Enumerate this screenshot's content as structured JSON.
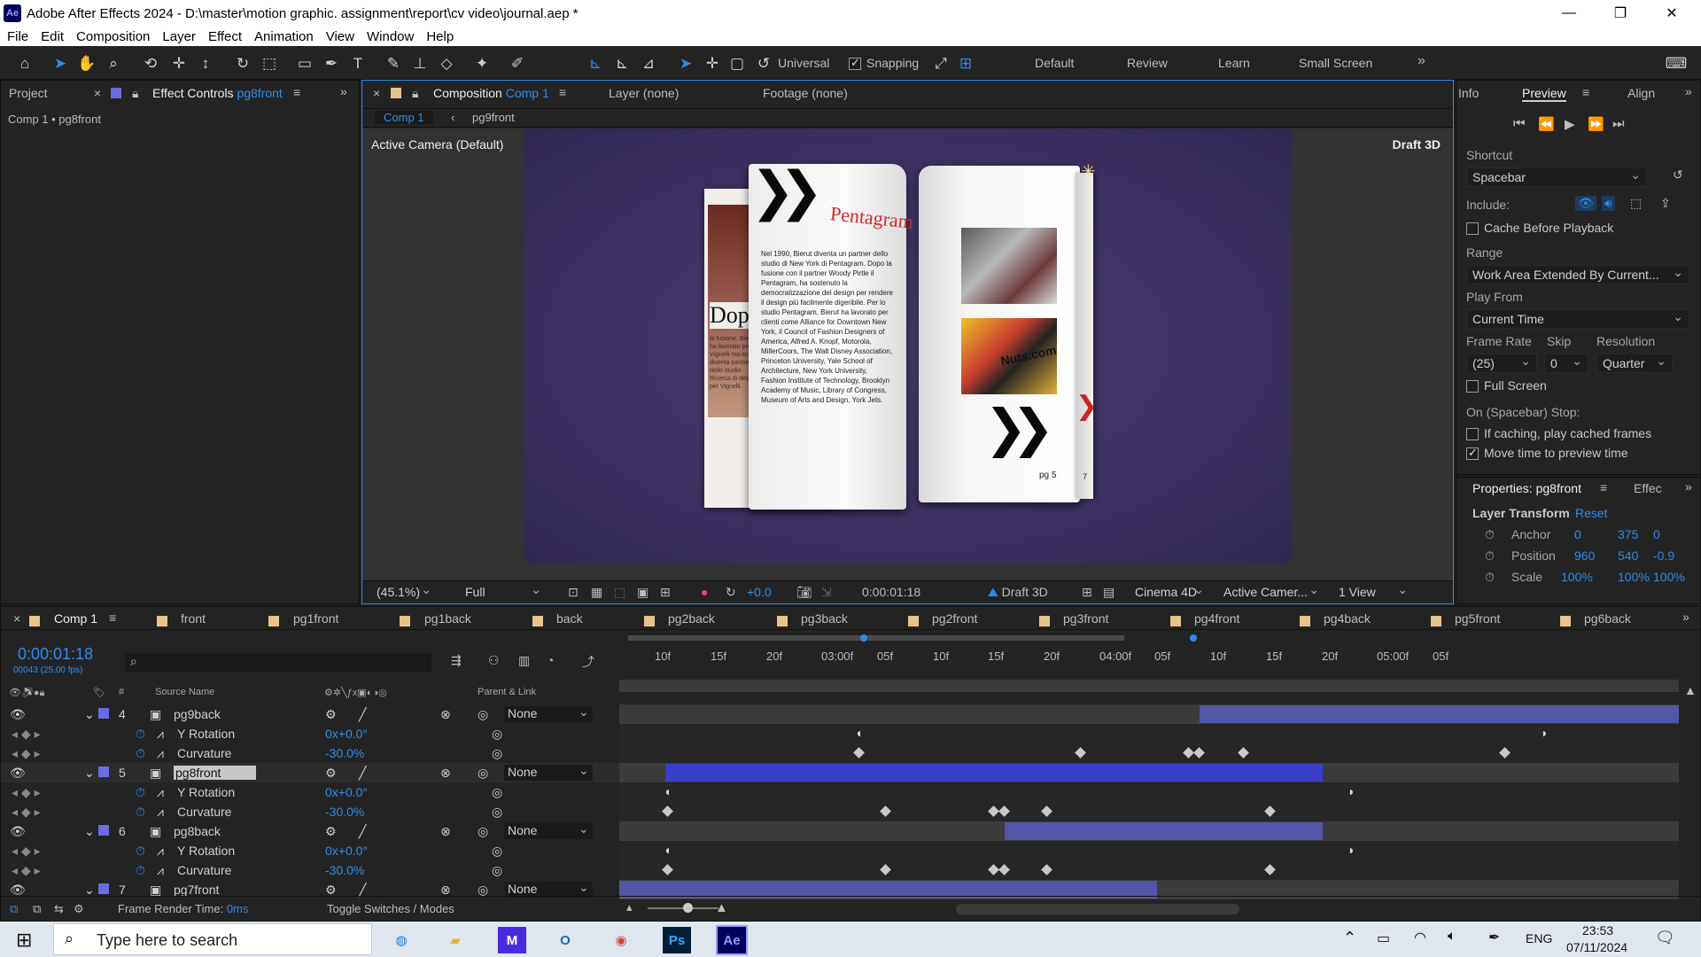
{
  "window": {
    "title": "Adobe After Effects 2024 - D:\\master\\motion graphic. assignment\\report\\cv video\\journal.aep *",
    "app_icon": "Ae"
  },
  "menu": [
    "File",
    "Edit",
    "Composition",
    "Layer",
    "Effect",
    "Animation",
    "View",
    "Window",
    "Help"
  ],
  "toolbar": {
    "axis_mode": "Universal",
    "snapping": "Snapping",
    "workspaces": [
      "Default",
      "Review",
      "Learn",
      "Small Screen"
    ]
  },
  "project_panel": {
    "tab_project": "Project",
    "tab_effect_controls": "Effect Controls",
    "effect_layer": "pg8front",
    "breadcrumb": "Comp 1 • pg8front"
  },
  "comp_panel": {
    "tab_label": "Composition",
    "comp_name": "Comp 1",
    "layer_tab": "Layer (none)",
    "footage_tab": "Footage (none)",
    "nav_comp": "Comp 1",
    "nav_layer": "pg9front",
    "camera": "Active Camera (Default)",
    "renderer_badge": "Draft 3D",
    "footer": {
      "zoom": "(45.1%)",
      "resolution": "Full",
      "exposure": "+0.0",
      "timecode": "0:00:01:18",
      "draft3d": "Draft 3D",
      "renderer": "Cinema 4D",
      "camera": "Active Camer...",
      "views": "1 View"
    },
    "book": {
      "left_title": "Pentagram",
      "left_body": "Nel 1990, Bierut diventa un partner dello studio di New York di Pentagram. Dopo la fusione con il partner Woody Pirtle il Pentagram, ha sostenuto la democratizzazione del design per rendere il design più facilmente digeribile. Per lo studio Pentagram, Bierut ha lavorato per clienti come Alliance for Downtown New York, il Council of Fashion Designers of America, Alfred A. Knopf, Motorola, MillerCoors, The Walt Disney Association, Princeton University, Yale School of Architecture, New York University, Fashion Institute of Technology, Brooklyn Academy of Music, Library of Congress, Museum of Arts and Design, York Jets.",
      "back_title": "Dopo",
      "back_body": "la fusione, Bierut ha lavorato per Vignelli ma anche diventa partner dello studio. Ricerca di design per Vignelli.",
      "page_number": "pg 5",
      "page_number_2": "7",
      "poster_text": "Nuts.com"
    }
  },
  "preview_panel": {
    "tab_info": "Info",
    "tab_preview": "Preview",
    "tab_align": "Align",
    "shortcut_label": "Shortcut",
    "shortcut": "Spacebar",
    "include_label": "Include:",
    "cache_before": "Cache Before Playback",
    "range_label": "Range",
    "range": "Work Area Extended By Current...",
    "playfrom_label": "Play From",
    "playfrom": "Current Time",
    "framerate_label": "Frame Rate",
    "skip_label": "Skip",
    "resolution_label": "Resolution",
    "framerate": "(25)",
    "skip": "0",
    "resolution": "Quarter",
    "fullscreen": "Full Screen",
    "onstop_label": "On (Spacebar) Stop:",
    "if_caching": "If caching, play cached frames",
    "move_time": "Move time to preview time"
  },
  "properties_panel": {
    "title": "Properties: pg8front",
    "tab_effects": "Effec",
    "section": "Layer Transform",
    "reset": "Reset",
    "anchor_label": "Anchor",
    "anchor": [
      "0",
      "375",
      "0"
    ],
    "position_label": "Position",
    "position": [
      "960",
      "540",
      "-0.9"
    ],
    "scale_label": "Scale",
    "scale": [
      "100%",
      "100%",
      "100%"
    ]
  },
  "timeline": {
    "tabs": [
      "Comp 1",
      "front",
      "pg1front",
      "pg1back",
      "back",
      "pg2back",
      "pg3back",
      "pg2front",
      "pg3front",
      "pg4front",
      "pg4back",
      "pg5front",
      "pg6back"
    ],
    "timecode": "0:00:01:18",
    "timecode_sub": "00043 (25.00 fps)",
    "search_placeholder": "",
    "col_source": "Source Name",
    "col_parent": "Parent & Link",
    "hash": "#",
    "ruler": [
      "10f",
      "15f",
      "20f",
      "03:00f",
      "05f",
      "10f",
      "15f",
      "20f",
      "04:00f",
      "05f",
      "10f",
      "15f",
      "20f",
      "05:00f",
      "05f"
    ],
    "layers": [
      {
        "num": "4",
        "name": "pg9back",
        "parent": "None",
        "yrot": "0x+0.0°",
        "curv": "-30.0%"
      },
      {
        "num": "5",
        "name": "pg8front",
        "parent": "None",
        "yrot": "0x+0.0°",
        "curv": "-30.0%"
      },
      {
        "num": "6",
        "name": "pg8back",
        "parent": "None",
        "yrot": "0x+0.0°",
        "curv": "-30.0%"
      },
      {
        "num": "7",
        "name": "pg7front",
        "parent": "None"
      }
    ],
    "prop_yrot": "Y Rotation",
    "prop_curv": "Curvature",
    "footer_render_label": "Frame Render Time:",
    "footer_render_value": "0ms",
    "footer_toggle": "Toggle Switches / Modes"
  },
  "taskbar": {
    "search_placeholder": "Type here to search",
    "lang": "ENG",
    "time": "23:53",
    "date": "07/11/2024"
  }
}
